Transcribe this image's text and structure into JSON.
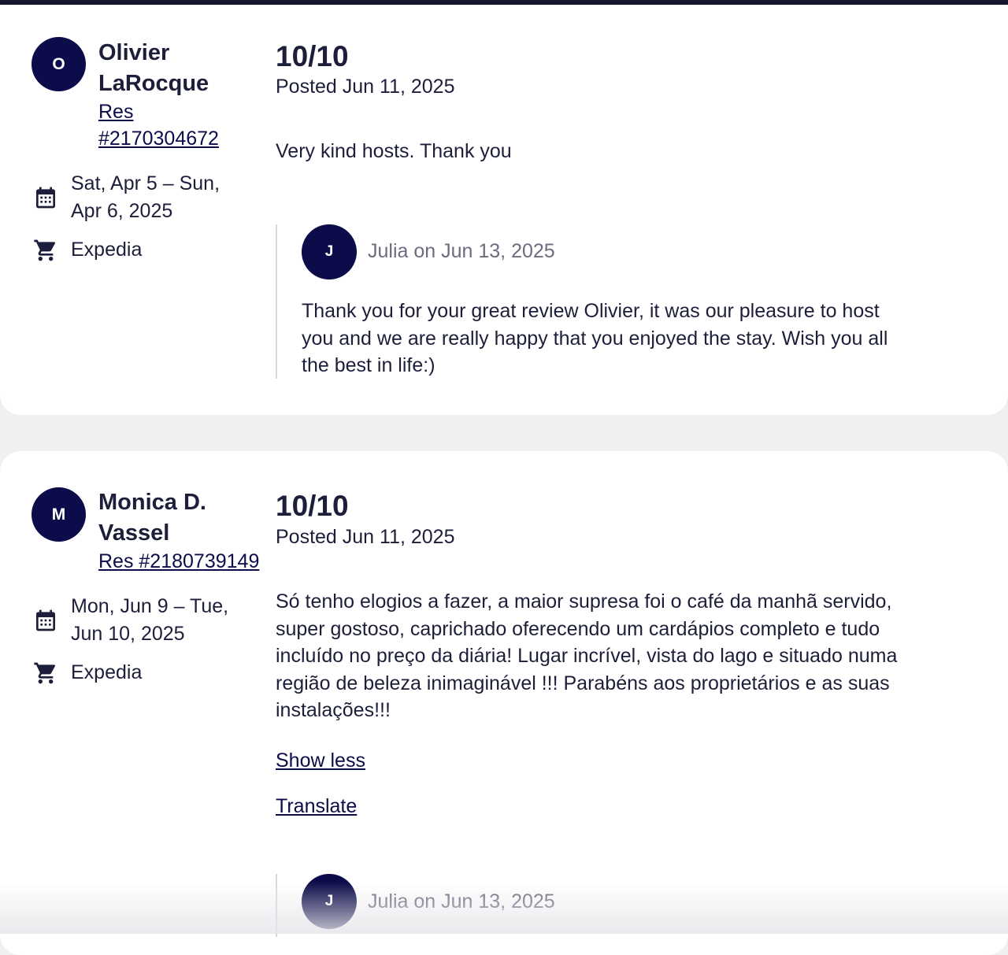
{
  "reviews": [
    {
      "avatar_initial": "O",
      "guest_name_line1": "Olivier",
      "guest_name_line2": "LaRocque",
      "res_line1": "Res",
      "res_line2": "#2170304672",
      "dates_line1": "Sat, Apr 5 – Sun,",
      "dates_line2": "Apr 6, 2025",
      "channel": "Expedia",
      "score": "10/10",
      "posted": "Posted Jun 11, 2025",
      "text": "Very kind hosts. Thank you",
      "reply": {
        "avatar_initial": "J",
        "author": "Julia on Jun 13, 2025",
        "line1": "Thank you for your great review Olivier, it was our pleasure to host",
        "line2": "you and we are really happy that you enjoyed the stay. Wish you all",
        "line3": "the best in life:)"
      }
    },
    {
      "avatar_initial": "M",
      "guest_name_line1": "Monica D.",
      "guest_name_line2": "Vassel",
      "res": "Res #2180739149",
      "dates_line1": "Mon, Jun 9 – Tue,",
      "dates_line2": "Jun 10, 2025",
      "channel": "Expedia",
      "score": "10/10",
      "posted": "Posted Jun 11, 2025",
      "text_line1": "Só tenho elogios a fazer, a maior supresa foi o café da manhã servido,",
      "text_line2": "super gostoso, caprichado oferecendo um cardápios completo e tudo",
      "text_line3": "incluído no preço da diária! Lugar incrível, vista do lago e situado numa",
      "text_line4": "região de beleza inimaginável !!! Parabéns aos proprietários e as suas",
      "text_line5": "instalações!!!",
      "show_less": "Show less",
      "translate": "Translate",
      "reply": {
        "avatar_initial": "J",
        "author": "Julia on Jun 13, 2025"
      }
    }
  ],
  "icons": {
    "calendar": "calendar-icon",
    "cart": "cart-icon"
  },
  "colors": {
    "avatar_bg": "#0c0c4a",
    "text": "#1d1f3a",
    "muted": "#6a6c80",
    "page_bg": "#f0f0f2"
  }
}
